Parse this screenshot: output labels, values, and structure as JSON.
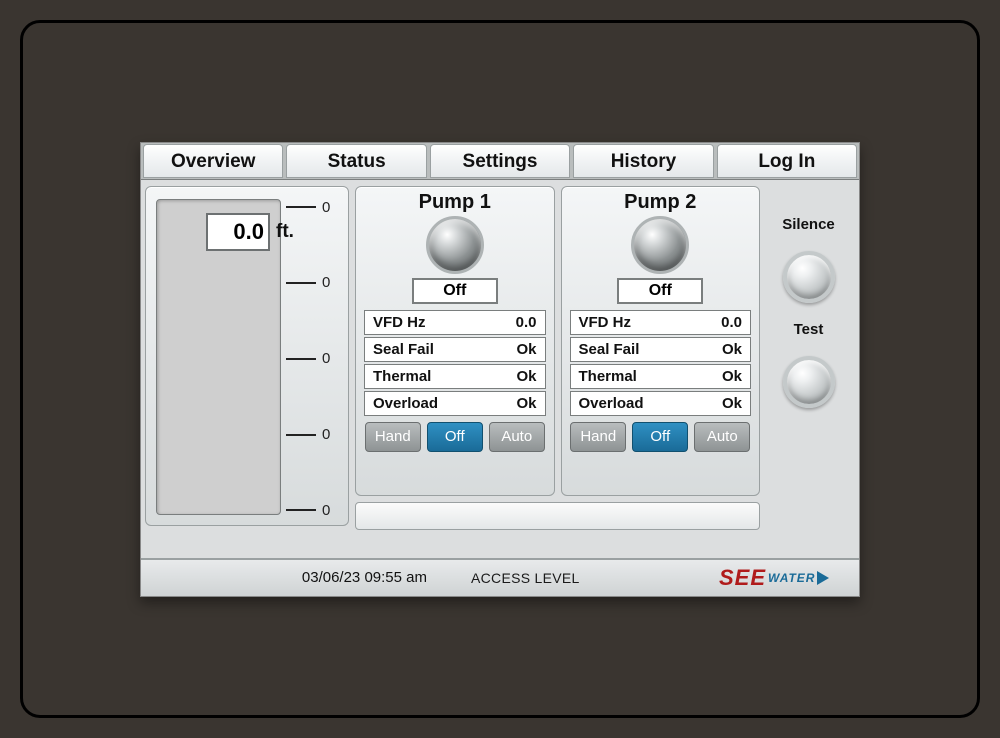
{
  "tabs": [
    "Overview",
    "Status",
    "Settings",
    "History",
    "Log In"
  ],
  "level": {
    "value": "0.0",
    "unit": "ft.",
    "ticks": [
      "0",
      "0",
      "0",
      "0",
      "0"
    ]
  },
  "pumps": [
    {
      "title": "Pump 1",
      "state": "Off",
      "rows": [
        {
          "k": "VFD Hz",
          "v": "0.0"
        },
        {
          "k": "Seal Fail",
          "v": "Ok"
        },
        {
          "k": "Thermal",
          "v": "Ok"
        },
        {
          "k": "Overload",
          "v": "Ok"
        }
      ],
      "modes": {
        "hand": "Hand",
        "off": "Off",
        "auto": "Auto",
        "active": "off"
      }
    },
    {
      "title": "Pump 2",
      "state": "Off",
      "rows": [
        {
          "k": "VFD Hz",
          "v": "0.0"
        },
        {
          "k": "Seal Fail",
          "v": "Ok"
        },
        {
          "k": "Thermal",
          "v": "Ok"
        },
        {
          "k": "Overload",
          "v": "Ok"
        }
      ],
      "modes": {
        "hand": "Hand",
        "off": "Off",
        "auto": "Auto",
        "active": "off"
      }
    }
  ],
  "side": {
    "silence": "Silence",
    "test": "Test"
  },
  "footer": {
    "datetime": "03/06/23 09:55 am",
    "access_label": "ACCESS LEVEL",
    "logo_main": "SEE",
    "logo_sub": "WATER"
  }
}
